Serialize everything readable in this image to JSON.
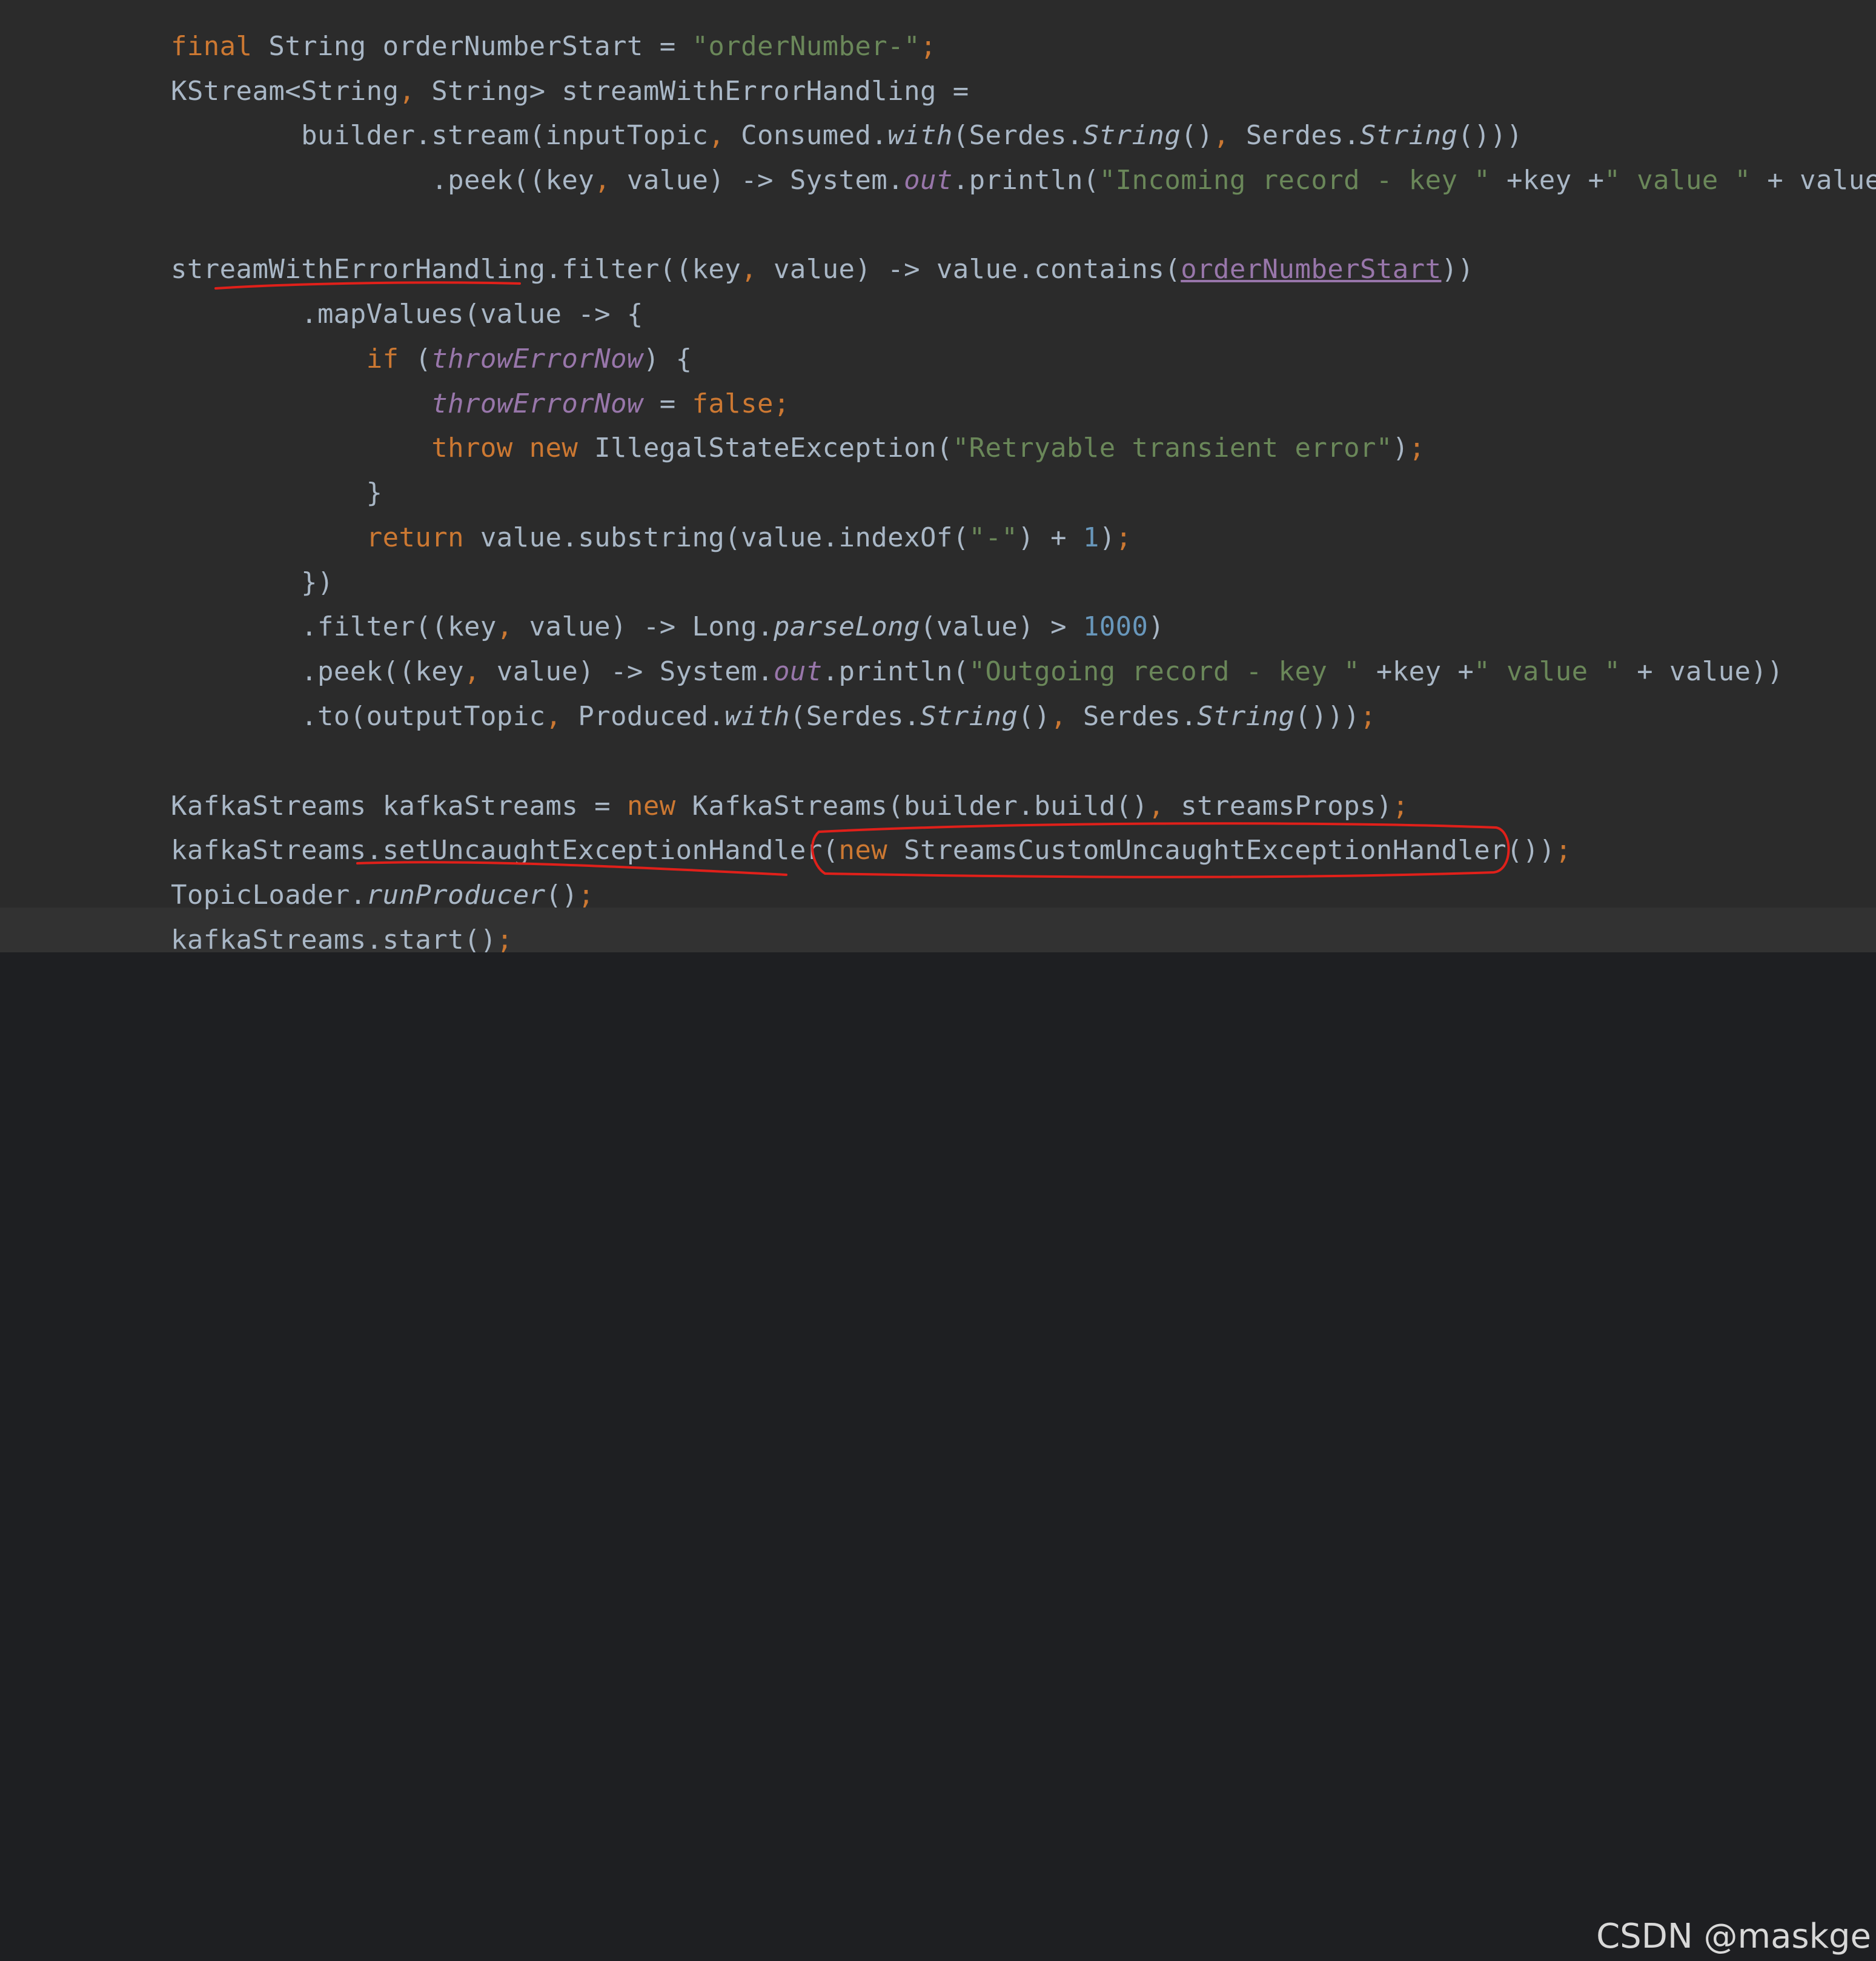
{
  "code": {
    "line01": [
      {
        "t": "final",
        "c": "kw"
      },
      {
        "t": " String orderNumberStart = "
      },
      {
        "t": "\"orderNumber-\"",
        "c": "str"
      },
      {
        "t": ";",
        "c": "kw"
      }
    ],
    "line02": [
      {
        "t": "KStream<String"
      },
      {
        "t": ",",
        "c": "kw"
      },
      {
        "t": " String> streamWithErrorHandling ="
      }
    ],
    "line03": [
      {
        "t": "        builder.stream(inputTopic"
      },
      {
        "t": ",",
        "c": "kw"
      },
      {
        "t": " Consumed."
      },
      {
        "t": "with",
        "c": "st"
      },
      {
        "t": "(Serdes."
      },
      {
        "t": "String",
        "c": "st"
      },
      {
        "t": "()"
      },
      {
        "t": ",",
        "c": "kw"
      },
      {
        "t": " Serdes."
      },
      {
        "t": "String",
        "c": "st"
      },
      {
        "t": "()))"
      }
    ],
    "line04": [
      {
        "t": "                .peek((key"
      },
      {
        "t": ",",
        "c": "kw"
      },
      {
        "t": " value) -> System."
      },
      {
        "t": "out",
        "c": "fld"
      },
      {
        "t": ".println("
      },
      {
        "t": "\"Incoming record - key \"",
        "c": "str"
      },
      {
        "t": " +key +"
      },
      {
        "t": "\" value \"",
        "c": "str"
      },
      {
        "t": " + value))"
      },
      {
        "t": ";",
        "c": "kw"
      }
    ],
    "line06": [
      {
        "t": "streamWithErrorHandling.filter((key"
      },
      {
        "t": ",",
        "c": "kw"
      },
      {
        "t": " value) -> value.contains("
      },
      {
        "t": "orderNumberStart",
        "c": "und"
      },
      {
        "t": "))"
      }
    ],
    "line07": [
      {
        "t": "        .mapValues(value -> {"
      }
    ],
    "line08": [
      {
        "t": "            "
      },
      {
        "t": "if",
        "c": "kw"
      },
      {
        "t": " ("
      },
      {
        "t": "throwErrorNow",
        "c": "fld"
      },
      {
        "t": ") {"
      }
    ],
    "line09": [
      {
        "t": "                "
      },
      {
        "t": "throwErrorNow",
        "c": "fld"
      },
      {
        "t": " = "
      },
      {
        "t": "false",
        "c": "kw"
      },
      {
        "t": ";",
        "c": "kw"
      }
    ],
    "line10": [
      {
        "t": "                "
      },
      {
        "t": "throw new",
        "c": "kw"
      },
      {
        "t": " IllegalStateException("
      },
      {
        "t": "\"Retryable transient error\"",
        "c": "str"
      },
      {
        "t": ")"
      },
      {
        "t": ";",
        "c": "kw"
      }
    ],
    "line11": [
      {
        "t": "            }"
      }
    ],
    "line12": [
      {
        "t": "            "
      },
      {
        "t": "return",
        "c": "kw"
      },
      {
        "t": " value.substring(value.indexOf("
      },
      {
        "t": "\"-\"",
        "c": "str"
      },
      {
        "t": ") + "
      },
      {
        "t": "1",
        "c": "num"
      },
      {
        "t": ")"
      },
      {
        "t": ";",
        "c": "kw"
      }
    ],
    "line13": [
      {
        "t": "        })"
      }
    ],
    "line14": [
      {
        "t": "        .filter((key"
      },
      {
        "t": ",",
        "c": "kw"
      },
      {
        "t": " value) -> Long."
      },
      {
        "t": "parseLong",
        "c": "st"
      },
      {
        "t": "(value) > "
      },
      {
        "t": "1000",
        "c": "num"
      },
      {
        "t": ")"
      }
    ],
    "line15": [
      {
        "t": "        .peek((key"
      },
      {
        "t": ",",
        "c": "kw"
      },
      {
        "t": " value) -> System."
      },
      {
        "t": "out",
        "c": "fld"
      },
      {
        "t": ".println("
      },
      {
        "t": "\"Outgoing record - key \"",
        "c": "str"
      },
      {
        "t": " +key +"
      },
      {
        "t": "\" value \"",
        "c": "str"
      },
      {
        "t": " + value))"
      }
    ],
    "line16": [
      {
        "t": "        .to(outputTopic"
      },
      {
        "t": ",",
        "c": "kw"
      },
      {
        "t": " Produced."
      },
      {
        "t": "with",
        "c": "st"
      },
      {
        "t": "(Serdes."
      },
      {
        "t": "String",
        "c": "st"
      },
      {
        "t": "()"
      },
      {
        "t": ",",
        "c": "kw"
      },
      {
        "t": " Serdes."
      },
      {
        "t": "String",
        "c": "st"
      },
      {
        "t": "()))"
      },
      {
        "t": ";",
        "c": "kw"
      }
    ],
    "line18": [
      {
        "t": "KafkaStreams kafkaStreams = "
      },
      {
        "t": "new",
        "c": "kw"
      },
      {
        "t": " KafkaStreams(builder.build()"
      },
      {
        "t": ",",
        "c": "kw"
      },
      {
        "t": " streamsProps)"
      },
      {
        "t": ";",
        "c": "kw"
      }
    ],
    "line19": [
      {
        "t": "kafkaStreams.setUncaughtExceptionHandler("
      },
      {
        "t": "new",
        "c": "kw"
      },
      {
        "t": " StreamsCustomUncaughtExceptionHandler())"
      },
      {
        "t": ";",
        "c": "kw"
      }
    ],
    "line20": [
      {
        "t": "TopicLoader."
      },
      {
        "t": "runProducer",
        "c": "st"
      },
      {
        "t": "()"
      },
      {
        "t": ";",
        "c": "kw"
      }
    ],
    "line21": [
      {
        "t": "kafkaStreams.start()"
      },
      {
        "t": ";",
        "c": "kw"
      }
    ]
  },
  "annotations": {
    "stroke_color": "#e0201a"
  },
  "watermark": "CSDN @maskge"
}
